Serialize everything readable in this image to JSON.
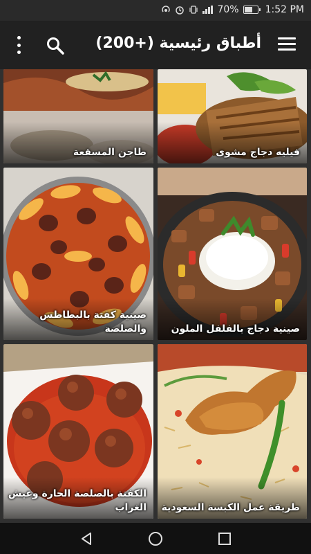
{
  "status": {
    "battery": "70%",
    "battery_level": 0.7,
    "time": "1:52 PM"
  },
  "app_bar": {
    "title": "أطباق رئيسية (+200)",
    "icons": [
      "menu-icon",
      "search-icon",
      "more-vert-icon"
    ]
  },
  "recipes": [
    {
      "title": "فيليه دجاج مشوى"
    },
    {
      "title": "طاجن المسقعة"
    },
    {
      "title": "صينية دجاج بالفلفل الملون"
    },
    {
      "title": "صينية كفتة بالبطاطس والصلصة"
    },
    {
      "title": "طريقة عمل الكبسة السعودية"
    },
    {
      "title": "الكفتة بالصلصة الحارة وعيش الغراب"
    }
  ],
  "nav": {
    "icons": [
      "back-icon",
      "home-icon",
      "recents-icon"
    ]
  }
}
